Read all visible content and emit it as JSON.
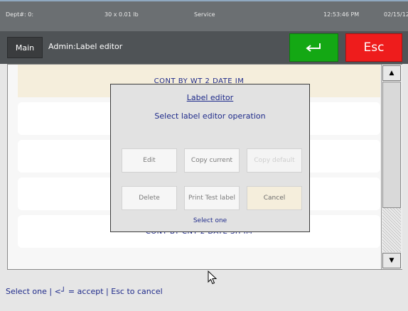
{
  "statusbar": {
    "dept": "Dept#: 0:",
    "weight": "30 x 0.01 lb",
    "mode": "Service",
    "time": "12:53:46 PM",
    "date": "02/15/12"
  },
  "titlebar": {
    "main_label": "Main",
    "title": "Admin:Label editor",
    "enter_icon": "enter-arrow-icon",
    "esc_label": "Esc",
    "colors": {
      "enter": "#14a814",
      "esc": "#ee1c1c"
    }
  },
  "list": {
    "rows": [
      "CONT BY WT 2 DATE IM",
      "",
      "",
      "",
      "CONT BY CNT 2 DATE SH IM"
    ]
  },
  "dialog": {
    "title": "Label editor",
    "subtitle": "Select label editor operation",
    "buttons": {
      "edit": "Edit",
      "copy_current": "Copy current",
      "copy_default": "Copy default",
      "delete": "Delete",
      "print_test": "Print Test label",
      "cancel": "Cancel"
    },
    "footer": "Select one"
  },
  "hint": "Select one | <┘ = accept | Esc to cancel"
}
